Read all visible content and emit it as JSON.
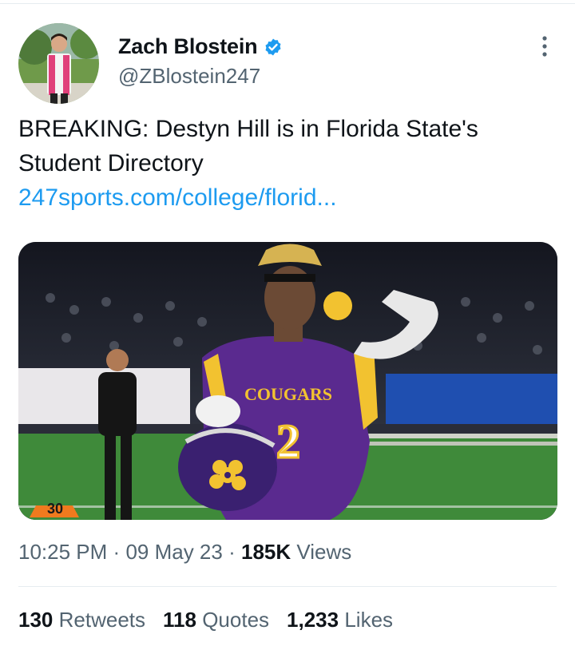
{
  "author": {
    "name": "Zach Blostein",
    "handle": "@ZBlostein247",
    "verified": true,
    "avatar_icon": "profile-photo"
  },
  "tweet": {
    "text": "BREAKING: Destyn Hill is in Florida State's Student Directory",
    "link": "247sports.com/college/florid..."
  },
  "media": {
    "jersey_text": "COUGARS",
    "jersey_number": "2",
    "yard_marker": "30",
    "colors": {
      "jersey": "#5a2a8f",
      "trim": "#f2c230",
      "field": "#3f8a3a"
    }
  },
  "meta": {
    "time": "10:25 PM",
    "date": "09 May 23",
    "views_count": "185K",
    "views_label": "Views"
  },
  "stats": {
    "retweets_count": "130",
    "retweets_label": "Retweets",
    "quotes_count": "118",
    "quotes_label": "Quotes",
    "likes_count": "1,233",
    "likes_label": "Likes"
  },
  "colors": {
    "link": "#1d9bf0",
    "secondary": "#536471",
    "verified": "#1d9bf0"
  }
}
